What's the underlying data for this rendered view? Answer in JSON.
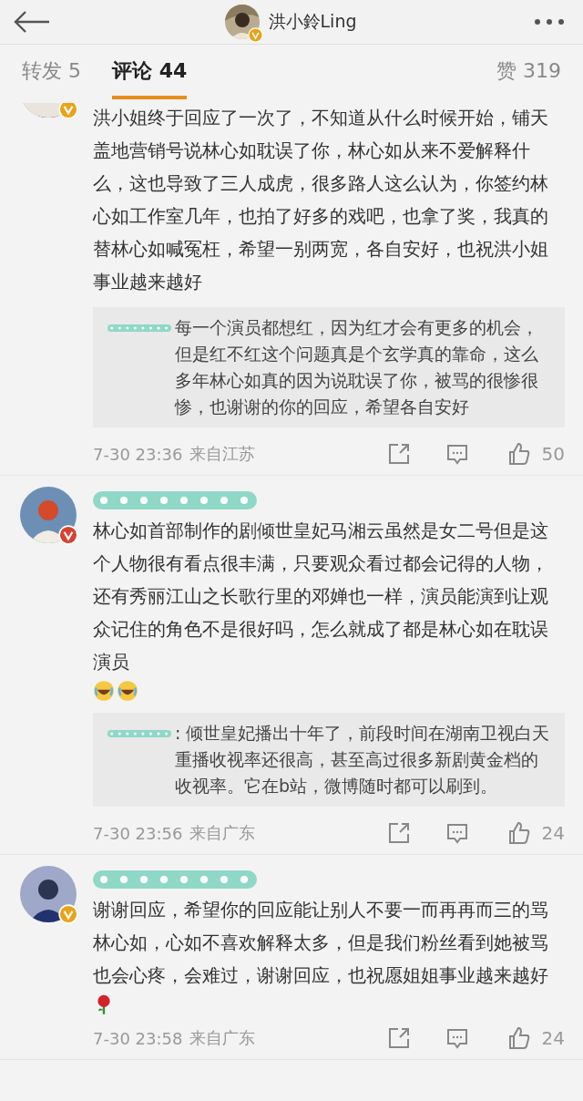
{
  "header": {
    "title": "洪小鈴Ling",
    "badge": {
      "color": "#e8a317"
    }
  },
  "tabs": [
    {
      "label": "转发",
      "count": "5",
      "selected": false
    },
    {
      "label": "评论",
      "count": "44",
      "selected": true
    },
    {
      "label": "赞",
      "count": "319",
      "selected": false
    }
  ],
  "comments": [
    {
      "badge": {
        "color": "#e8a317"
      },
      "redacted_name": false,
      "text": "洪小姐终于回应了一次了，不知道从什么时候开始，铺天盖地营销号说林心如耽误了你，林心如从来不爱解释什么，这也导致了三人成虎，很多路人这么认为，你签约林心如工作室几年，也拍了好多的戏吧，也拿了奖，我真的替林心如喊冤枉，希望一别两宽，各自安好，也祝洪小姐事业越来越好",
      "reply": "每一个演员都想红，因为红才会有更多的机会，但是红不红这个问题真是个玄学真的靠命，这么多年林心如真的因为说耽误了你，被骂的很惨很惨，也谢谢的你的回应，希望各自安好",
      "time": "7-30 23:36",
      "location": "来自江苏",
      "likes": "50"
    },
    {
      "badge": {
        "color": "#d8412f"
      },
      "redacted_name": true,
      "text": "林心如首部制作的剧倾世皇妃马湘云虽然是女二号但是这个人物很有看点很丰满，只要观众看过都会记得的人物，还有秀丽江山之长歌行里的邓婵也一样，演员能演到让观众记住的角色不是很好吗，怎么就成了都是林心如在耽误演员",
      "emojis": [
        {
          "kind": "laugh"
        },
        {
          "kind": "laugh"
        }
      ],
      "reply": ": 倾世皇妃播出十年了，前段时间在湖南卫视白天重播收视率还很高，甚至高过很多新剧黄金档的收视率。它在b站，微博随时都可以刷到。",
      "time": "7-30 23:56",
      "location": "来自广东",
      "likes": "24"
    },
    {
      "badge": {
        "color": "#e8a317"
      },
      "redacted_name": true,
      "text": "谢谢回应，希望你的回应能让别人不要一而再再而三的骂林心如，心如不喜欢解释太多，但是我们粉丝看到她被骂也会心疼，会难过，谢谢回应，也祝愿姐姐事业越来越好",
      "emojis": [
        {
          "kind": "rose"
        }
      ],
      "time": "7-30 23:58",
      "location": "来自广东",
      "likes": "24"
    }
  ]
}
